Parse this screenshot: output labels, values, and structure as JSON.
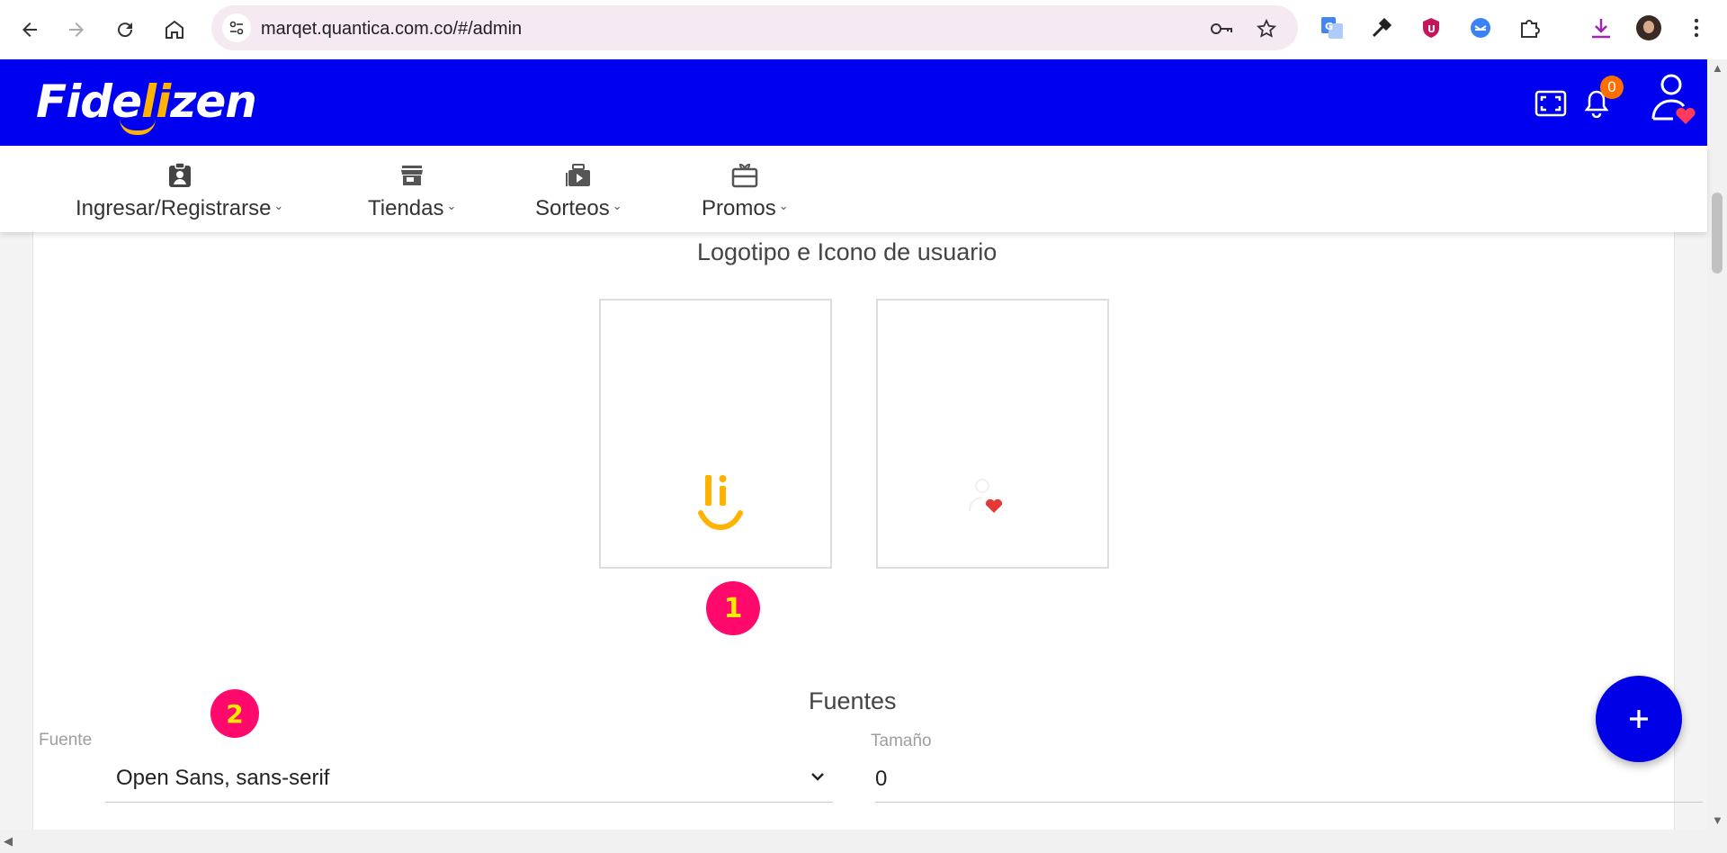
{
  "browser": {
    "url": "marqet.quantica.com.co/#/admin",
    "back_icon": "back-arrow-icon",
    "forward_icon": "forward-arrow-icon",
    "reload_icon": "reload-icon",
    "home_icon": "home-icon"
  },
  "app": {
    "brand_prefix": "Fide",
    "brand_accent": "li",
    "brand_suffix": "zen",
    "notification_count": "0",
    "colors": {
      "header": "#0000f0",
      "accent": "#ffb300",
      "badge": "#ff0a6c",
      "fab": "#0000e6"
    }
  },
  "menu": {
    "items": [
      {
        "label": "Ingresar/Registrarse",
        "icon": "clipboard-badge-icon"
      },
      {
        "label": "Tiendas",
        "icon": "store-icon"
      },
      {
        "label": "Sorteos",
        "icon": "play-stack-icon"
      },
      {
        "label": "Promos",
        "icon": "gift-card-icon"
      }
    ]
  },
  "main": {
    "logo_section_title": "Logotipo e Icono de usuario",
    "step1": "1",
    "step2": "2",
    "fonts_section_title": "Fuentes",
    "font_label": "Fuente",
    "font_value": "Open Sans, sans-serif",
    "size_label": "Tamaño",
    "size_value": "0",
    "fab_icon": "plus-icon"
  }
}
